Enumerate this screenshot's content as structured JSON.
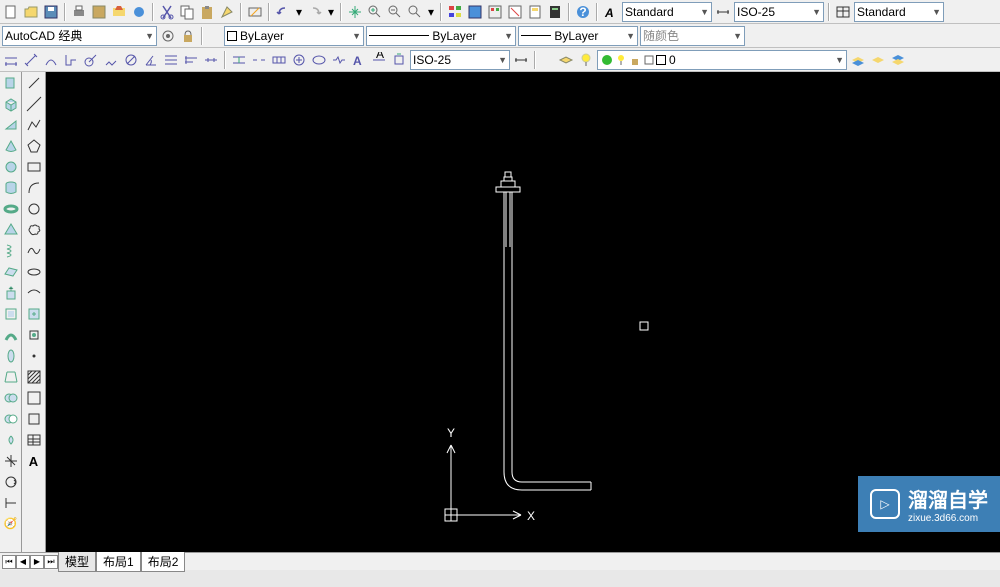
{
  "toolbar1": {
    "style_dropdown1": "Standard",
    "style_dropdown2": "ISO-25",
    "style_dropdown3": "Standard"
  },
  "toolbar2": {
    "workspace": "AutoCAD 经典",
    "layer_color": "ByLayer",
    "linetype": "ByLayer",
    "lineweight": "ByLayer",
    "plot_style": "随颜色"
  },
  "toolbar3": {
    "dim_style": "ISO-25",
    "layer_state": "0"
  },
  "canvas": {
    "x_axis": "X",
    "y_axis": "Y"
  },
  "tabs": {
    "model": "模型",
    "layout1": "布局1",
    "layout2": "布局2"
  },
  "watermark": {
    "title": "溜溜自学",
    "sub": "zixue.3d66.com"
  }
}
